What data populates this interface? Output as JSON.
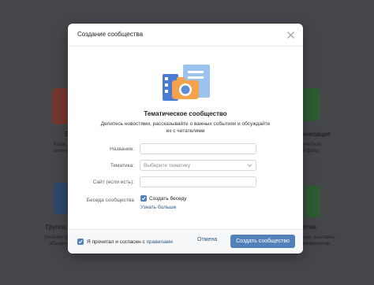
{
  "background": {
    "cards": [
      {
        "title": "Б",
        "desc_lines": [
          "Кафе, магазин",
          "кинотеатр"
        ]
      },
      {
        "title": "анизация",
        "desc_lines": [
          "учебное",
          "й фонд"
        ]
      },
      {
        "title": "Группа о",
        "desc_lines": [
          "Учебная групп",
          "объедин"
        ]
      },
      {
        "title": "ятие",
        "desc_lines": [
          "ция, выставка,",
          "конференци"
        ]
      }
    ]
  },
  "modal": {
    "title": "Создание сообщества",
    "type_title": "Тематическое сообщество",
    "type_desc": "Делитесь новостями, рассказывайте о важных событиях и обсуждайте их с читателями",
    "form": {
      "name_label": "Название:",
      "name_value": "",
      "topic_label": "Тематика:",
      "topic_placeholder": "Выберите тематику",
      "site_label": "Сайт (если есть):",
      "site_value": "",
      "chat_label": "Беседа сообщества",
      "create_chat_label": "Создать беседу",
      "create_chat_checked": true,
      "learn_more": "Узнать больше"
    },
    "footer": {
      "agree_text": "Я прочитал и согласен с",
      "agree_link": "правилами",
      "agree_checked": true,
      "cancel_label": "Отмена",
      "create_label": "Создать сообщество"
    }
  },
  "colors": {
    "accent": "#5181b8",
    "link": "#2a5885"
  }
}
